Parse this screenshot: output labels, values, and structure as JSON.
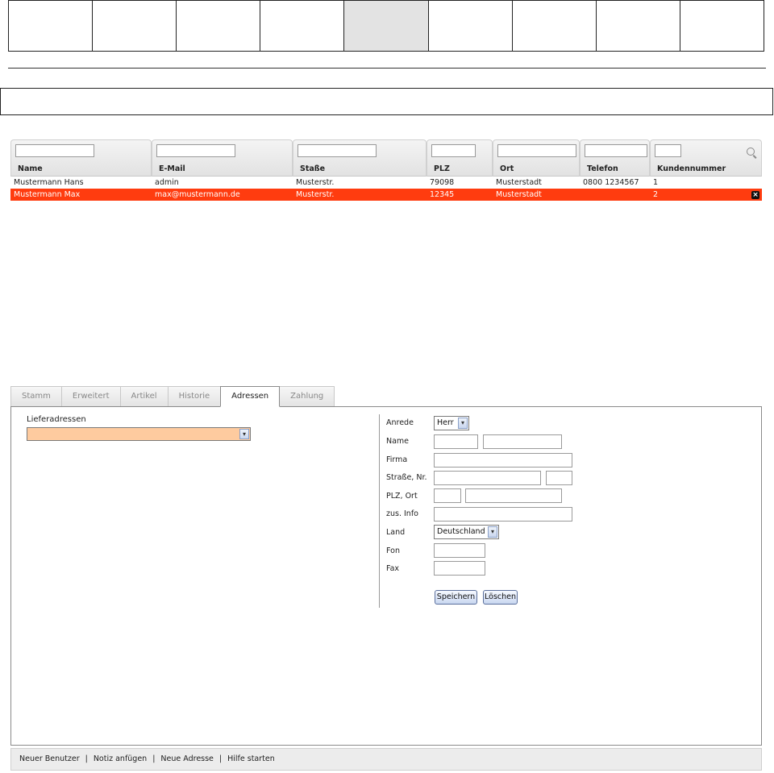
{
  "grid": {
    "columns": [
      "Name",
      "E-Mail",
      "Staße",
      "PLZ",
      "Ort",
      "Telefon",
      "Kundennummer"
    ],
    "rows": [
      [
        "Mustermann Hans",
        "admin",
        "Musterstr.",
        "79098",
        "Musterstadt",
        "0800 1234567",
        "1"
      ],
      [
        "Mustermann Max",
        "max@mustermann.de",
        "Musterstr.",
        "12345",
        "Musterstadt",
        "",
        "2"
      ]
    ],
    "selected_row": 1,
    "icons": {
      "search": "search-icon",
      "delete": "delete-icon"
    }
  },
  "tabs": [
    "Stamm",
    "Erweitert",
    "Artikel",
    "Historie",
    "Adressen",
    "Zahlung"
  ],
  "active_tab": "Adressen",
  "lieferadressen": {
    "label": "Lieferadressen",
    "value": ""
  },
  "form": {
    "anrede": {
      "label": "Anrede",
      "value": "Herr"
    },
    "name": {
      "label": "Name"
    },
    "firma": {
      "label": "Firma"
    },
    "strasse": {
      "label": "Straße, Nr."
    },
    "plz_ort": {
      "label": "PLZ, Ort"
    },
    "zus_info": {
      "label": "zus. Info"
    },
    "land": {
      "label": "Land",
      "value": "Deutschland"
    },
    "fon": {
      "label": "Fon"
    },
    "fax": {
      "label": "Fax"
    },
    "save_label": "Speichern",
    "delete_label": "Löschen"
  },
  "footer": {
    "links": [
      "Neuer Benutzer",
      "Notiz anfügen",
      "Neue Adresse",
      "Hilfe starten"
    ]
  },
  "colors": {
    "selected_row": "#ff3c0f",
    "select_highlight": "#fecb9f",
    "active_nav": "#e3e3e3"
  }
}
